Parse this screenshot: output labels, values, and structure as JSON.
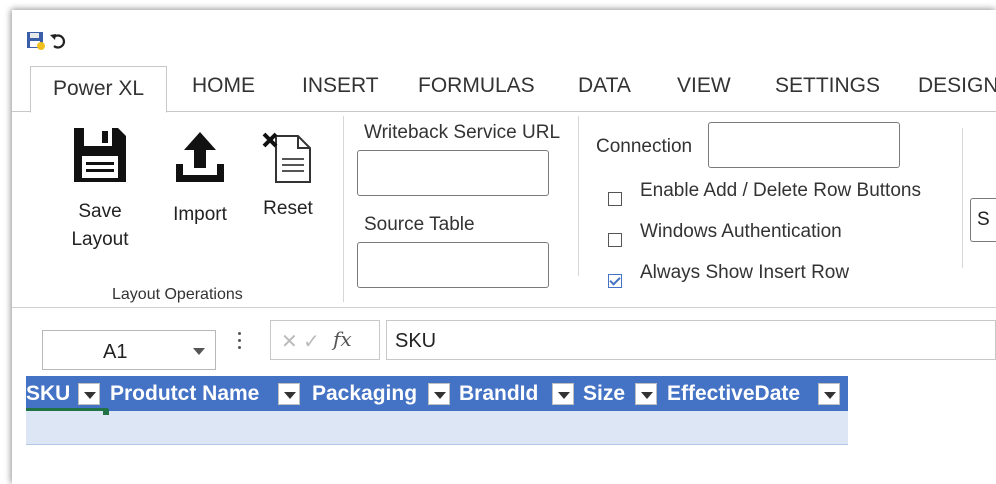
{
  "quick_access": {
    "save_icon": "save-disk-icon",
    "undo_icon": "undo-icon"
  },
  "tabs": [
    {
      "label": "Power XL",
      "active": true
    },
    {
      "label": "HOME"
    },
    {
      "label": "INSERT"
    },
    {
      "label": "FORMULAS"
    },
    {
      "label": "DATA"
    },
    {
      "label": "VIEW"
    },
    {
      "label": "SETTINGS"
    },
    {
      "label": "DESIGN"
    }
  ],
  "ribbon": {
    "layout_ops": {
      "save_label_1": "Save",
      "save_label_2": "Layout",
      "import_label": "Import",
      "reset_label": "Reset",
      "group_label": "Layout Operations"
    },
    "writeback": {
      "url_label": "Writeback Service URL",
      "url_value": "",
      "source_label": "Source Table",
      "source_value": ""
    },
    "connection": {
      "label": "Connection",
      "value": "",
      "options": [
        {
          "label": "Enable Add / Delete Row Buttons",
          "checked": false
        },
        {
          "label": "Windows Authentication",
          "checked": false
        },
        {
          "label": "Always Show Insert Row",
          "checked": true
        }
      ]
    },
    "cut_off_text": "S"
  },
  "formula_bar": {
    "name_box": "A1",
    "cancel_glyph": "✕",
    "enter_glyph": "✓",
    "fx_label": "fx",
    "formula": "SKU"
  },
  "table": {
    "columns": [
      "SKU",
      "Produtct Name",
      "Packaging",
      "BrandId",
      "Size",
      "EffectiveDate"
    ],
    "header_color": "#4472c4",
    "row_color": "#dce6f4"
  }
}
